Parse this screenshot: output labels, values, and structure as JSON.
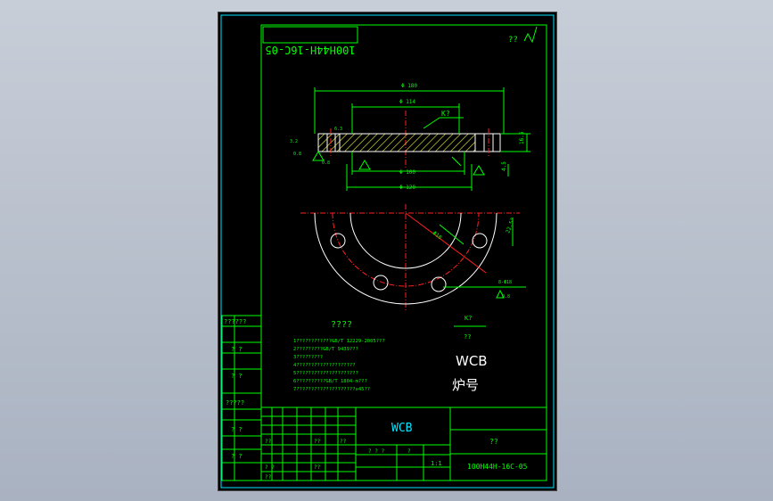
{
  "drawing": {
    "corner_code_mirrored": "100H44H-16C-05",
    "surface_mark": "??",
    "dims": {
      "outer_dia": "Φ 180",
      "bolt_dia": "Φ 114",
      "bore_dia": "Φ 100",
      "inner_dia": "Φ 88",
      "spigot_dia": "Φ 120",
      "thickness": "16.5",
      "step": "4.5",
      "k_mark": "K?",
      "left_note": "3.2",
      "left_note2": "0.8",
      "left_note3": "6.3",
      "left_note4": "0.8",
      "hole_note": "8-Φ18",
      "angle_note": "22.5°",
      "rad_note": "Φ18",
      "small_note": "0.8"
    },
    "tech_title": "????",
    "tech_lines": [
      "1????????????GB/T 12229-2005???",
      "2?????????GB/T 9439???",
      "3?????????",
      "4????????????????????",
      "5?????????????????????",
      "6??????????GB/T 1804-m???",
      "7????????????????????x45??"
    ],
    "fraction_top": "K?",
    "fraction_bottom": "??",
    "material_label": "WCB",
    "heat_label": "炉号"
  },
  "left_strip": [
    "??????",
    "? ?",
    "? ?",
    "?????",
    "? ?",
    "? ?"
  ],
  "title_block": {
    "material": "WCB",
    "name": "??",
    "code": "100H44H-16C-05",
    "scale_cells": [
      "? ? ?",
      "?",
      "1:1"
    ],
    "sign_labels": [
      "??",
      "??",
      "??",
      "? ?",
      "??",
      "??"
    ]
  }
}
